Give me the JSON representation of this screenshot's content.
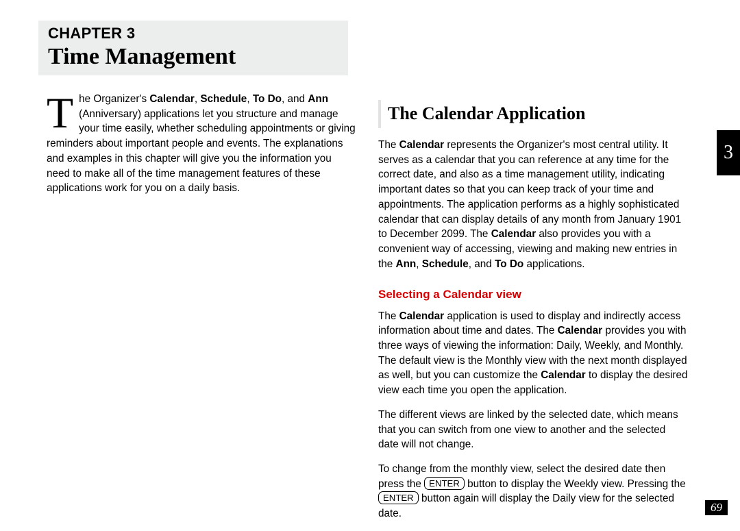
{
  "chapter": {
    "label": "CHAPTER 3",
    "title": "Time Management",
    "tab": "3",
    "page": "69"
  },
  "intro": {
    "dropcap": "T",
    "lead_frag1": "he Organizer's ",
    "bold_calendar": "Calendar",
    "comma1": ", ",
    "bold_schedule": "Schedule",
    "comma2": ", ",
    "bold_todo": "To Do",
    "and_text": ", and ",
    "bold_ann": "Ann",
    "ann_paren": " (Anniversary) applications let you structure and manage your time easily, whether scheduling appointments or giving reminders about important people and events. The explanations and examples in this chapter will give you the information you need to make all of the time management features of these applications work for you on a daily basis."
  },
  "section": {
    "heading": "The Calendar Application",
    "p1_a": "The ",
    "p1_b_cal": "Calendar",
    "p1_b": " represents the Organizer's most central utility. It serves as a calendar that you can reference at any time for the correct date, and also as a time management utility, indicating important dates so that you can keep track of your time and appointments. The application performs as a highly sophisticated calendar that can display details of any month from January 1901 to December 2099. The ",
    "p1_c_cal": "Calendar",
    "p1_c": " also provides you with a convenient way of accessing, viewing and making new entries in the ",
    "p1_ann": "Ann",
    "p1_d": ", ",
    "p1_sched": "Schedule",
    "p1_e": ", and ",
    "p1_todo": "To Do",
    "p1_f": " applications."
  },
  "sub": {
    "heading": "Selecting a Calendar view",
    "p2_a": "The ",
    "p2_cal1": "Calendar",
    "p2_b": " application is used to display and indirectly access information about time and dates. The ",
    "p2_cal2": "Calendar",
    "p2_c": " provides you with three ways of viewing the information: Daily, Weekly, and Monthly.  The default view is the Monthly view with the next month displayed as well, but you can customize the ",
    "p2_cal3": "Calendar",
    "p2_d": " to display the desired view each time you open the application.",
    "p3": "The different views are linked by the selected date, which means that you can switch from one view to another and the selected date will not change.",
    "p4_a": "To change from the monthly view, select the desired date then press the ",
    "key_enter": "ENTER",
    "p4_b": " button to display the Weekly view. Pressing the ",
    "p4_c": " button again will display the Daily view for the selected date."
  }
}
